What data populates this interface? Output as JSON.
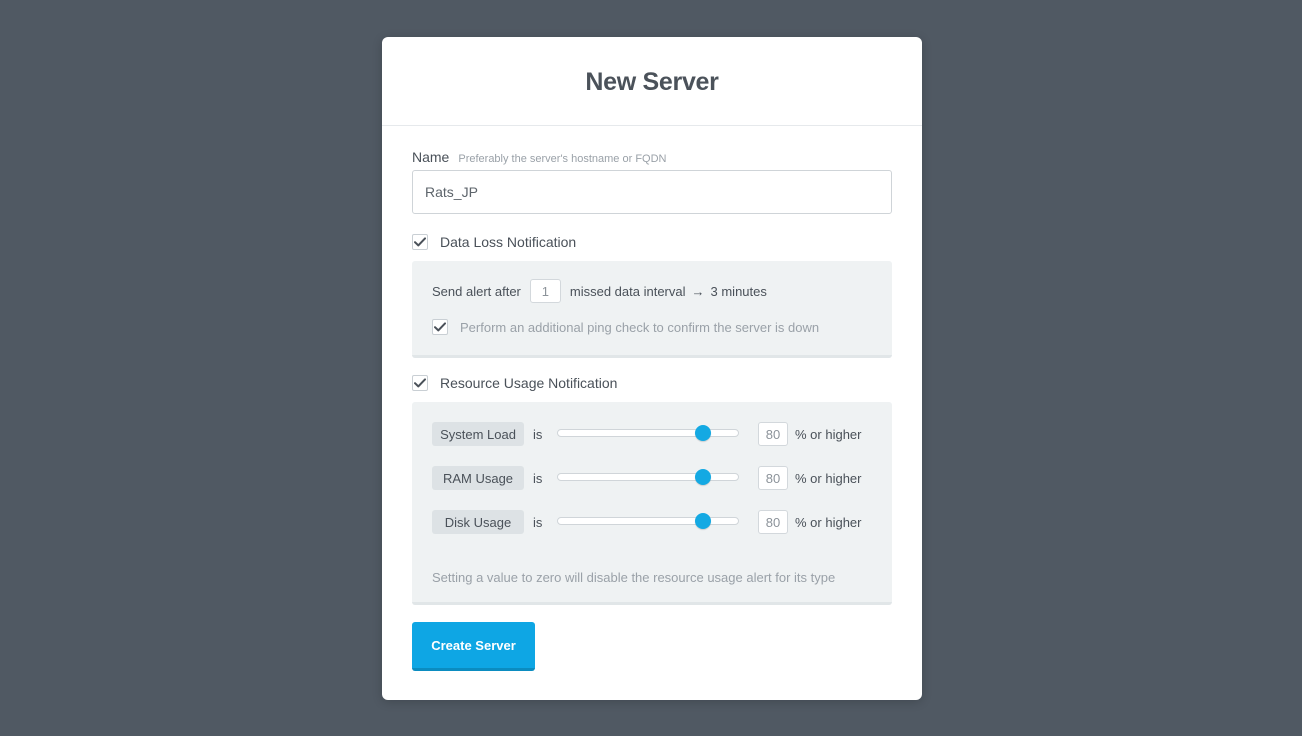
{
  "form": {
    "title": "New Server",
    "name_label": "Name",
    "name_hint": "Preferably the server's hostname or FQDN",
    "name_value": "Rats_JP"
  },
  "data_loss": {
    "checked": true,
    "label": "Data Loss Notification",
    "send_alert_prefix": "Send alert after",
    "missed_intervals": "1",
    "interval_text": "missed data interval",
    "arrow": "→",
    "interval_duration": "3 minutes",
    "ping_check_checked": true,
    "ping_check_label": "Perform an additional ping check to confirm the server is down"
  },
  "resource_usage": {
    "checked": true,
    "label": "Resource Usage Notification",
    "connector": "is",
    "suffix": "% or higher",
    "items": [
      {
        "label": "System Load",
        "value": "80",
        "level_percent": 80
      },
      {
        "label": "RAM Usage",
        "value": "80",
        "level_percent": 80
      },
      {
        "label": "Disk Usage",
        "value": "80",
        "level_percent": 80
      }
    ],
    "note": "Setting a value to zero will disable the resource usage alert for its type"
  },
  "actions": {
    "create_label": "Create Server"
  },
  "colors": {
    "background": "#505963",
    "accent": "#0ea6e4",
    "slider_thumb": "#14a9e3"
  },
  "icons": {
    "checkbox_checked": "check-icon"
  }
}
